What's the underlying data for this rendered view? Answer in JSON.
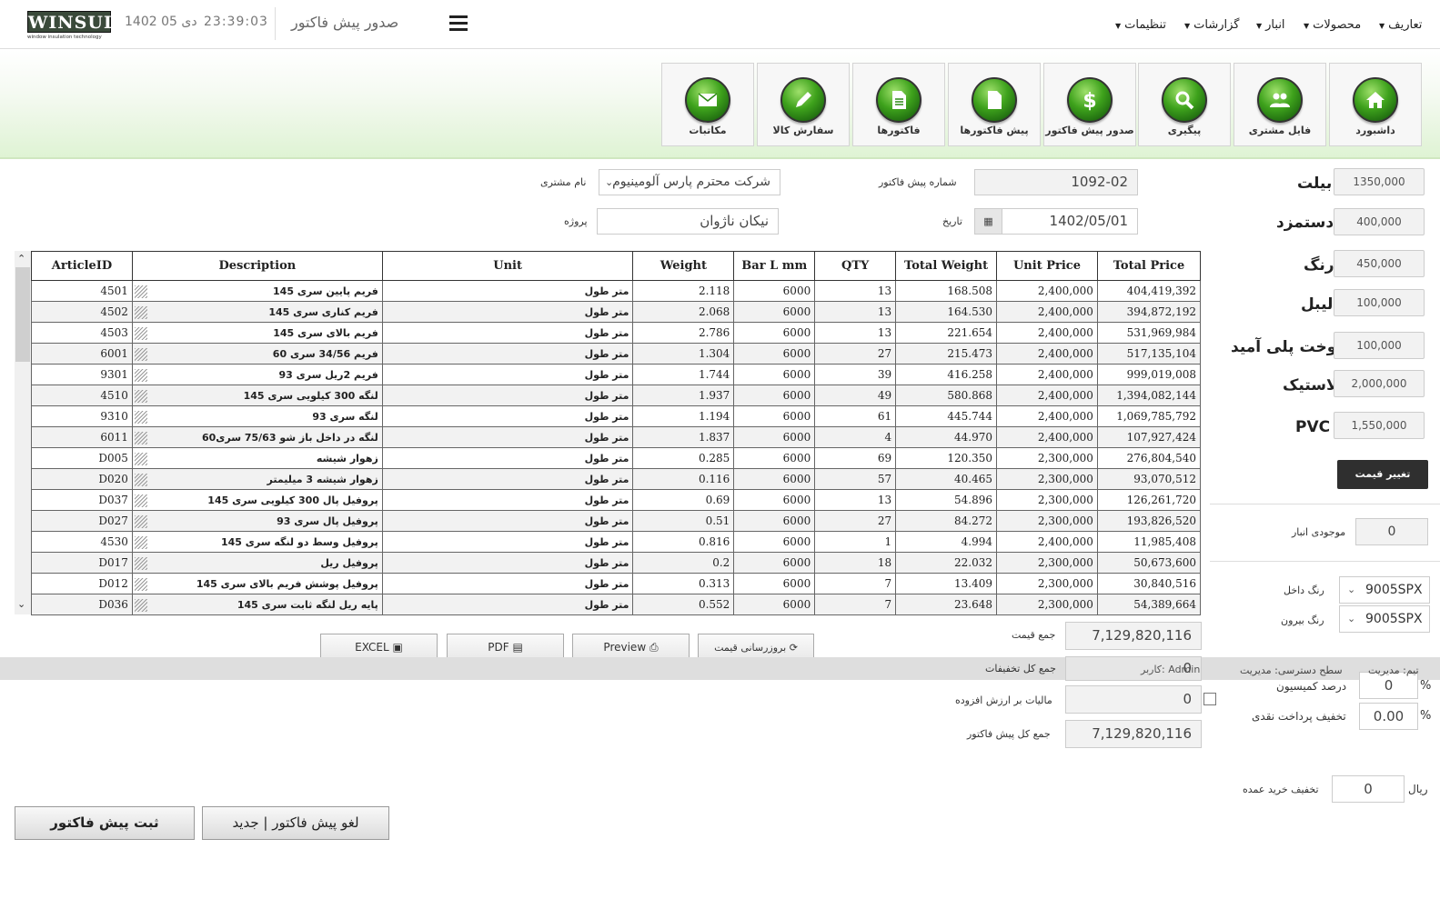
{
  "topbar": {
    "logo_text": "WINSUL",
    "logo_sub": "window insulation technology",
    "date": "1402 دی 05",
    "time": "23:39:03",
    "page_title": "صدور پیش فاکتور",
    "menu": [
      {
        "label": "تعاریف"
      },
      {
        "label": "محصولات"
      },
      {
        "label": "انبار"
      },
      {
        "label": "گزارشات"
      },
      {
        "label": "تنظیمات"
      }
    ]
  },
  "tiles": [
    {
      "label": "داشبورد",
      "icon": "home-icon"
    },
    {
      "label": "فایل مشتری",
      "icon": "users-icon"
    },
    {
      "label": "پیگیری",
      "icon": "search-icon"
    },
    {
      "label": "صدور پیش فاکتور",
      "icon": "dollar-icon"
    },
    {
      "label": "پیش فاکتورها",
      "icon": "document-icon"
    },
    {
      "label": "فاکتورها",
      "icon": "invoice-icon"
    },
    {
      "label": "سفارش کالا",
      "icon": "pencil-icon"
    },
    {
      "label": "مکاتبات",
      "icon": "mail-icon"
    }
  ],
  "form": {
    "customer_label": "نام مشتری",
    "customer_value": "شرکت محترم پارس آلومینیوم",
    "project_label": "پروژه",
    "project_value": "نیکان ناژوان",
    "invoice_no_label": "شماره پیش فاکتور",
    "invoice_no_value": "1092-02",
    "date_label": "تاریخ",
    "date_value": "1402/05/01"
  },
  "prices": [
    {
      "label": "بیلت",
      "value": "1350,000"
    },
    {
      "label": "دستمزد",
      "value": "400,000"
    },
    {
      "label": "رنگ",
      "value": "450,000"
    },
    {
      "label": "لیبل",
      "value": "100,000"
    },
    {
      "label": "دوخت پلی آمید",
      "value": "100,000"
    },
    {
      "label": "لاستیک",
      "value": "2,000,000"
    },
    {
      "label": "PVC",
      "value": "1,550,000"
    }
  ],
  "change_price_label": "تغییر قیمت",
  "stock": {
    "label": "موجودی انبار",
    "value": "0"
  },
  "color_in": {
    "label": "رنگ داخل",
    "value": "9005SPX"
  },
  "color_out": {
    "label": "رنگ بیرون",
    "value": "9005SPX"
  },
  "table": {
    "headers": [
      "ArticleID",
      "Description",
      "Unit",
      "Weight",
      "Bar L mm",
      "QTY",
      "Total Weight",
      "Unit Price",
      "Total Price"
    ],
    "rows": [
      [
        "4501",
        "فریم پایین سری 145",
        "متر طول",
        "2.118",
        "6000",
        "13",
        "168.508",
        "2,400,000",
        "404,419,392"
      ],
      [
        "4502",
        "فریم کناری سری 145",
        "متر طول",
        "2.068",
        "6000",
        "13",
        "164.530",
        "2,400,000",
        "394,872,192"
      ],
      [
        "4503",
        "فریم بالای سری 145",
        "متر طول",
        "2.786",
        "6000",
        "13",
        "221.654",
        "2,400,000",
        "531,969,984"
      ],
      [
        "6001",
        "فریم 34/56 سری 60",
        "متر طول",
        "1.304",
        "6000",
        "27",
        "215.473",
        "2,400,000",
        "517,135,104"
      ],
      [
        "9301",
        "فریم 2ریل سری 93",
        "متر طول",
        "1.744",
        "6000",
        "39",
        "416.258",
        "2,400,000",
        "999,019,008"
      ],
      [
        "4510",
        "لنگه 300 کیلویی سری 145",
        "متر طول",
        "1.937",
        "6000",
        "49",
        "580.868",
        "2,400,000",
        "1,394,082,144"
      ],
      [
        "9310",
        "لنگه سری 93",
        "متر طول",
        "1.194",
        "6000",
        "61",
        "445.744",
        "2,400,000",
        "1,069,785,792"
      ],
      [
        "6011",
        "لنگه در داخل باز شو 75/63 سری60",
        "متر طول",
        "1.837",
        "6000",
        "4",
        "44.970",
        "2,400,000",
        "107,927,424"
      ],
      [
        "D005",
        "زهوار شیشه",
        "متر طول",
        "0.285",
        "6000",
        "69",
        "120.350",
        "2,300,000",
        "276,804,540"
      ],
      [
        "D020",
        "زهوار شیشه 3 میلیمتر",
        "متر طول",
        "0.116",
        "6000",
        "57",
        "40.465",
        "2,300,000",
        "93,070,512"
      ],
      [
        "D037",
        "پروفیل پال 300 کیلویی سری 145",
        "متر طول",
        "0.69",
        "6000",
        "13",
        "54.896",
        "2,300,000",
        "126,261,720"
      ],
      [
        "D027",
        "پروفیل پال سری 93",
        "متر طول",
        "0.51",
        "6000",
        "27",
        "84.272",
        "2,300,000",
        "193,826,520"
      ],
      [
        "4530",
        "پروفیل وسط دو لنگه سری 145",
        "متر طول",
        "0.816",
        "6000",
        "1",
        "4.994",
        "2,400,000",
        "11,985,408"
      ],
      [
        "D017",
        "پروفیل ریل",
        "متر طول",
        "0.2",
        "6000",
        "18",
        "22.032",
        "2,300,000",
        "50,673,600"
      ],
      [
        "D012",
        "پروفیل پوشش فریم بالای سری 145",
        "متر طول",
        "0.313",
        "6000",
        "7",
        "13.409",
        "2,300,000",
        "30,840,516"
      ],
      [
        "D036",
        "پایه ریل لنگه ثابت سری 145",
        "متر طول",
        "0.552",
        "6000",
        "7",
        "23.648",
        "2,300,000",
        "54,389,664"
      ]
    ]
  },
  "actions": {
    "excel": "EXCEL",
    "pdf": "PDF",
    "preview": "Preview",
    "refresh": "بروزرسانی قیمت"
  },
  "totals": {
    "sum_label": "جمع قیمت",
    "sum_value": "7,129,820,116",
    "discount_label": "جمع کل تخفیفات",
    "discount_value": "0",
    "vat_label": "مالیات بر ارزش افزوده",
    "vat_value": "0",
    "grand_label": "جمع کل پیش فاکتور",
    "grand_value": "7,129,820,116"
  },
  "status": {
    "team": "تیم: مدیریت",
    "access": "سطح دسترسی: مدیریت",
    "user": "کاربر: Admin"
  },
  "commission": {
    "label": "درصد کمیسیون",
    "value": "0",
    "unit": "%"
  },
  "cash_discount": {
    "label": "تخفیف پرداخت نقدی",
    "value": "0.00",
    "unit": "%"
  },
  "bulk_discount": {
    "label": "تخفیف خرید عمده",
    "value": "0",
    "unit": "ریال"
  },
  "buttons": {
    "save": "ثبت پیش فاکتور",
    "cancel": "لغو پیش فاکتور | جدید"
  }
}
